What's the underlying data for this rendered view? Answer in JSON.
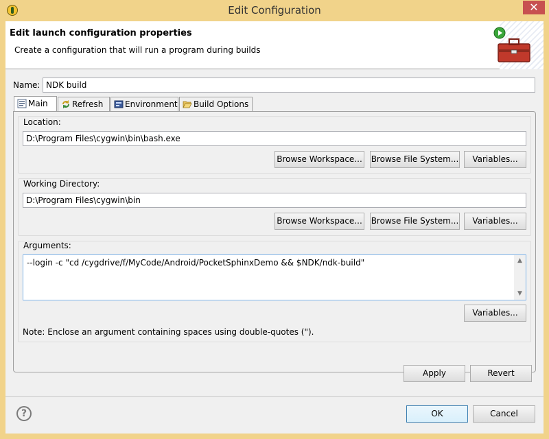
{
  "window": {
    "title": "Edit Configuration",
    "close_glyph": "✕"
  },
  "banner": {
    "title": "Edit launch configuration properties",
    "description": "Create a configuration that will run a program during builds",
    "icon": "toolbox-run-icon"
  },
  "name_field": {
    "label": "Name:",
    "value": "NDK build"
  },
  "tabs": [
    {
      "label": "Main",
      "icon": "main-tab-icon",
      "active": true
    },
    {
      "label": "Refresh",
      "icon": "refresh-icon",
      "active": false
    },
    {
      "label": "Environment",
      "icon": "environment-icon",
      "active": false
    },
    {
      "label": "Build Options",
      "icon": "folder-open-icon",
      "active": false
    }
  ],
  "location": {
    "label": "Location:",
    "value": "D:\\Program Files\\cygwin\\bin\\bash.exe",
    "browse_workspace": "Browse Workspace...",
    "browse_filesystem": "Browse File System...",
    "variables": "Variables..."
  },
  "working_directory": {
    "label": "Working Directory:",
    "value": "D:\\Program Files\\cygwin\\bin",
    "browse_workspace": "Browse Workspace...",
    "browse_filesystem": "Browse File System...",
    "variables": "Variables..."
  },
  "arguments": {
    "label": "Arguments:",
    "value": "--login -c \"cd /cygdrive/f/MyCode/Android/PocketSphinxDemo && $NDK/ndk-build\"",
    "variables": "Variables...",
    "note": "Note: Enclose an argument containing spaces using double-quotes (\")."
  },
  "apply_label": "Apply",
  "revert_label": "Revert",
  "ok_label": "OK",
  "cancel_label": "Cancel",
  "help_glyph": "?",
  "colors": {
    "title_bar": "#f1d38a",
    "close_button": "#c75050",
    "default_button_border": "#3c7fb1"
  }
}
